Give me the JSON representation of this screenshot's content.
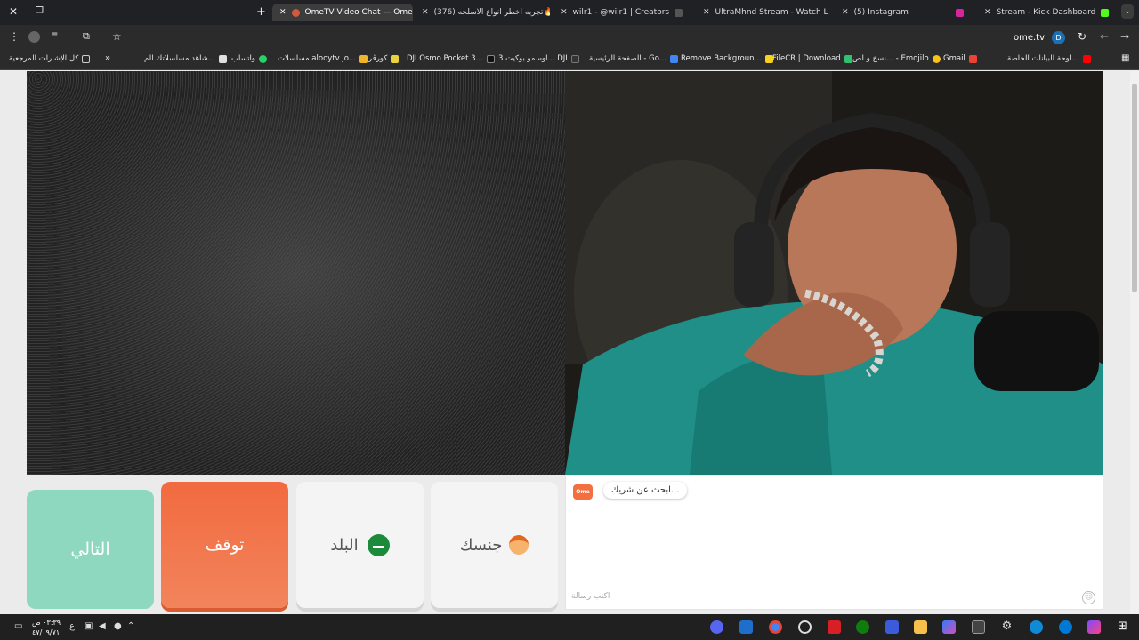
{
  "browser": {
    "tabs": [
      {
        "label": "OmeTV Video Chat — Ome",
        "active": true,
        "favicon": "#d05a3c"
      },
      {
        "label": "(376) تجربه اخطر انواع الاسلحه🔥",
        "favicon": "#ff0000"
      },
      {
        "label": "wilr1 - @wilr1 | Creators",
        "favicon": "#444444"
      },
      {
        "label": "UltraMhnd Stream - Watch Live",
        "favicon": "#53fc18"
      },
      {
        "label": "(5) Instagram",
        "favicon": "#d6249f"
      },
      {
        "label": "Stream - Kick Dashboard",
        "favicon": "#53fc18"
      }
    ],
    "address": "ome.tv",
    "account_initial": "D",
    "bookmarks": [
      "لوحة البيانات الخاصة...",
      "Gmail",
      "نسخ و لص... - Emojilo",
      "FileCR | Download",
      "Remove Backgroun...",
      "الصفحة الرئيسية - Go...",
      "اوسمو بوكيت 3... DJI",
      "DJI Osmo Pocket 3...",
      "كورڤر",
      "مسلسلات alooytv jo...",
      "واتساب",
      "شاهد مسلسلاتك الم...",
      "كل الإشارات المرجعية"
    ]
  },
  "controls": {
    "next_label": "التالي",
    "stop_label": "توقف",
    "country_label": "البلد",
    "gender_label": "جنسك"
  },
  "chat": {
    "status_bubble": "ابحث عن شريك...",
    "logo_text": "Ome TV",
    "message_placeholder": "اكتب رسالة"
  },
  "taskbar": {
    "time": "٠٣:٣٩ ص",
    "date": "٤٧/٠٩/٧١",
    "lang": "ع"
  }
}
